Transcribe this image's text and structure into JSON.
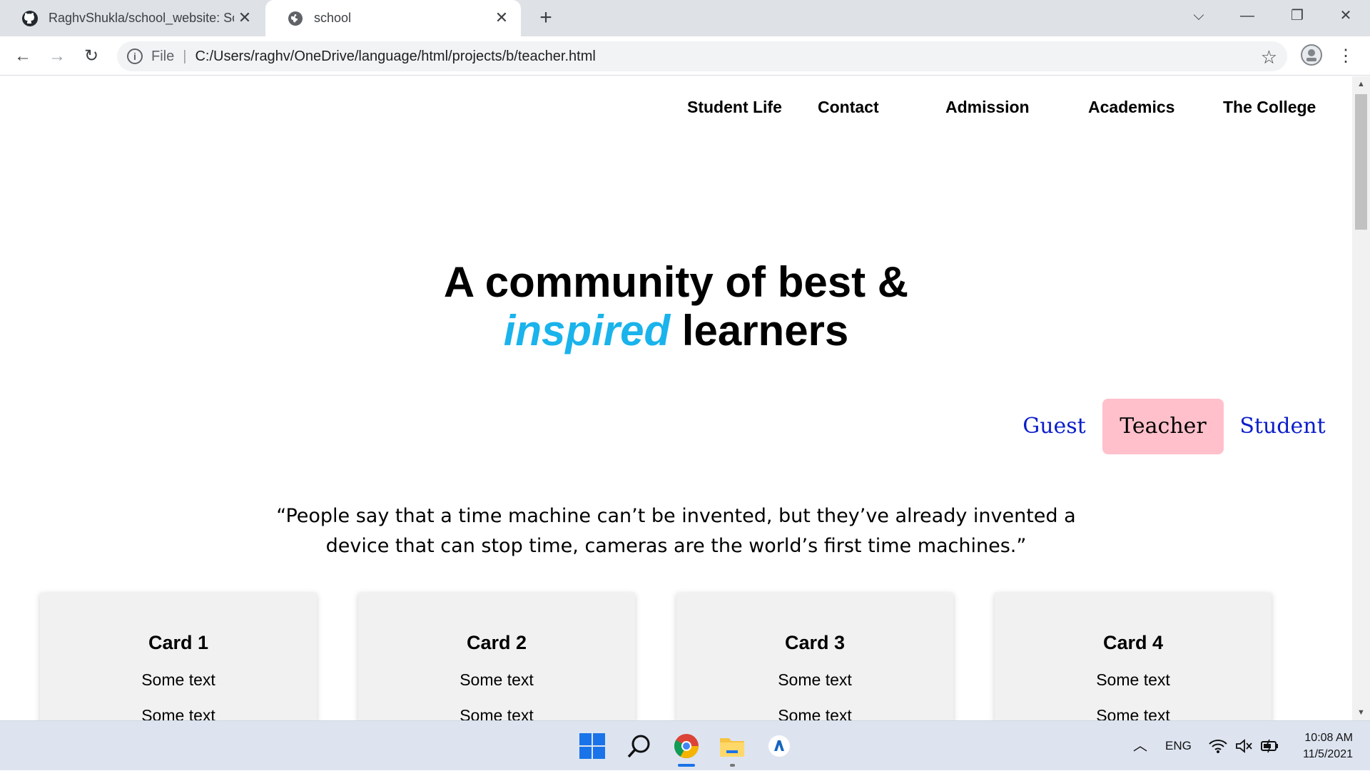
{
  "browser": {
    "tabs": [
      {
        "title": "RaghvShukla/school_website: Sch",
        "icon": "github-icon",
        "active": false
      },
      {
        "title": "school",
        "icon": "globe-icon",
        "active": true
      }
    ],
    "new_tab": "+",
    "address": {
      "scheme": "File",
      "url": "C:/Users/raghv/OneDrive/language/html/projects/b/teacher.html"
    }
  },
  "site": {
    "nav": [
      "Student Life",
      "Contact",
      "Admission",
      "Academics",
      "The College"
    ],
    "hero": {
      "line1": "A community of best &",
      "accent": "inspired",
      "line2_rest": " learners"
    },
    "roles": [
      {
        "label": "Guest",
        "active": false
      },
      {
        "label": "Teacher",
        "active": true
      },
      {
        "label": "Student",
        "active": false
      }
    ],
    "quote_line1": "“People say that a time machine can’t be invented, but they’ve already invented a",
    "quote_line2": "device that can stop time, cameras are the world’s first time machines.”",
    "cards": [
      {
        "title": "Card 1",
        "text1": "Some text",
        "text2": "Some text"
      },
      {
        "title": "Card 2",
        "text1": "Some text",
        "text2": "Some text"
      },
      {
        "title": "Card 3",
        "text1": "Some text",
        "text2": "Some text"
      },
      {
        "title": "Card 4",
        "text1": "Some text",
        "text2": "Some text"
      }
    ],
    "colors": {
      "accent": "#1ab3eb",
      "active_role_bg": "#ffc0cb",
      "role_link": "#0b1ec9"
    }
  },
  "taskbar": {
    "language": "ENG",
    "time": "10:08 AM",
    "date": "11/5/2021"
  }
}
